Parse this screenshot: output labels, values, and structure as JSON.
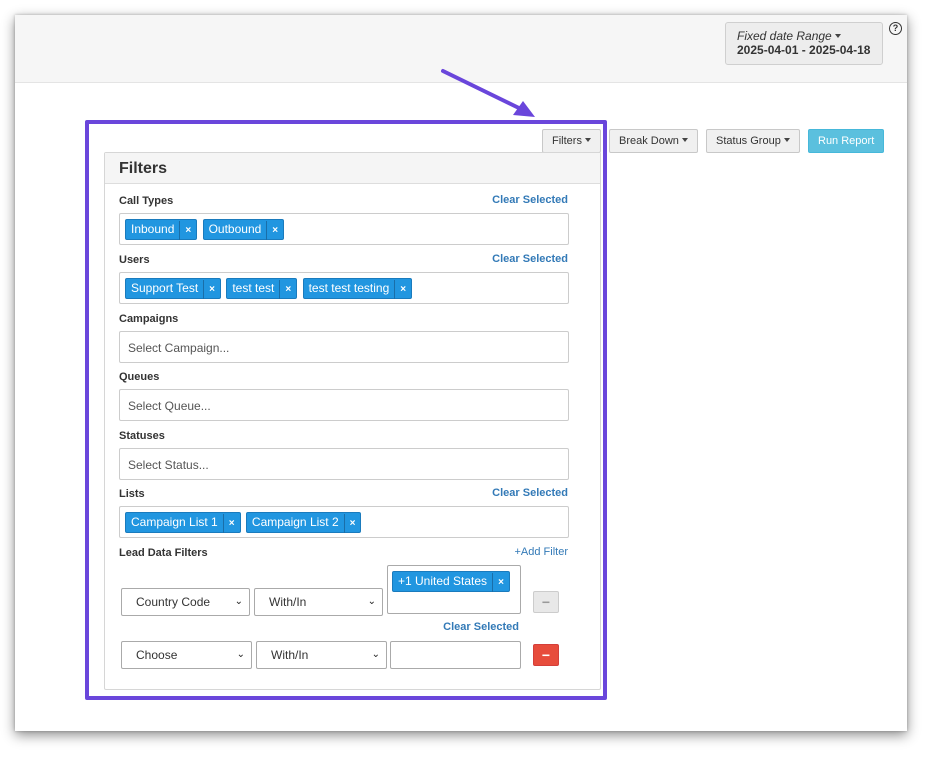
{
  "header": {
    "date_range_label": "Fixed date Range",
    "date_range_value": "2025-04-01 - 2025-04-18",
    "help": "?"
  },
  "toolbar": {
    "filters": "Filters",
    "break_down": "Break Down",
    "status_group": "Status Group",
    "run_report": "Run Report"
  },
  "filters": {
    "title": "Filters",
    "clear_label": "Clear Selected",
    "call_types": {
      "label": "Call Types",
      "tags": [
        "Inbound",
        "Outbound"
      ]
    },
    "users": {
      "label": "Users",
      "tags": [
        "Support Test",
        "test test",
        "test test testing"
      ]
    },
    "campaigns": {
      "label": "Campaigns",
      "placeholder": "Select Campaign..."
    },
    "queues": {
      "label": "Queues",
      "placeholder": "Select Queue..."
    },
    "statuses": {
      "label": "Statuses",
      "placeholder": "Select Status..."
    },
    "lists": {
      "label": "Lists",
      "tags": [
        "Campaign List 1",
        "Campaign List 2"
      ]
    },
    "lead_data": {
      "label": "Lead Data Filters",
      "add_filter": "+Add Filter",
      "rows": [
        {
          "field": "Country Code",
          "operator": "With/In",
          "tags": [
            "+1 United States"
          ]
        },
        {
          "field": "Choose",
          "operator": "With/In",
          "tags": []
        }
      ]
    }
  },
  "colors": {
    "highlight": "#6a46db",
    "tag": "#2196e0",
    "link": "#337ab7",
    "run_button": "#5bc0de",
    "remove_button": "#e74c3c"
  },
  "icons": {
    "tag_remove": "×",
    "minus": "−",
    "dropdown_caret": "⌄"
  }
}
